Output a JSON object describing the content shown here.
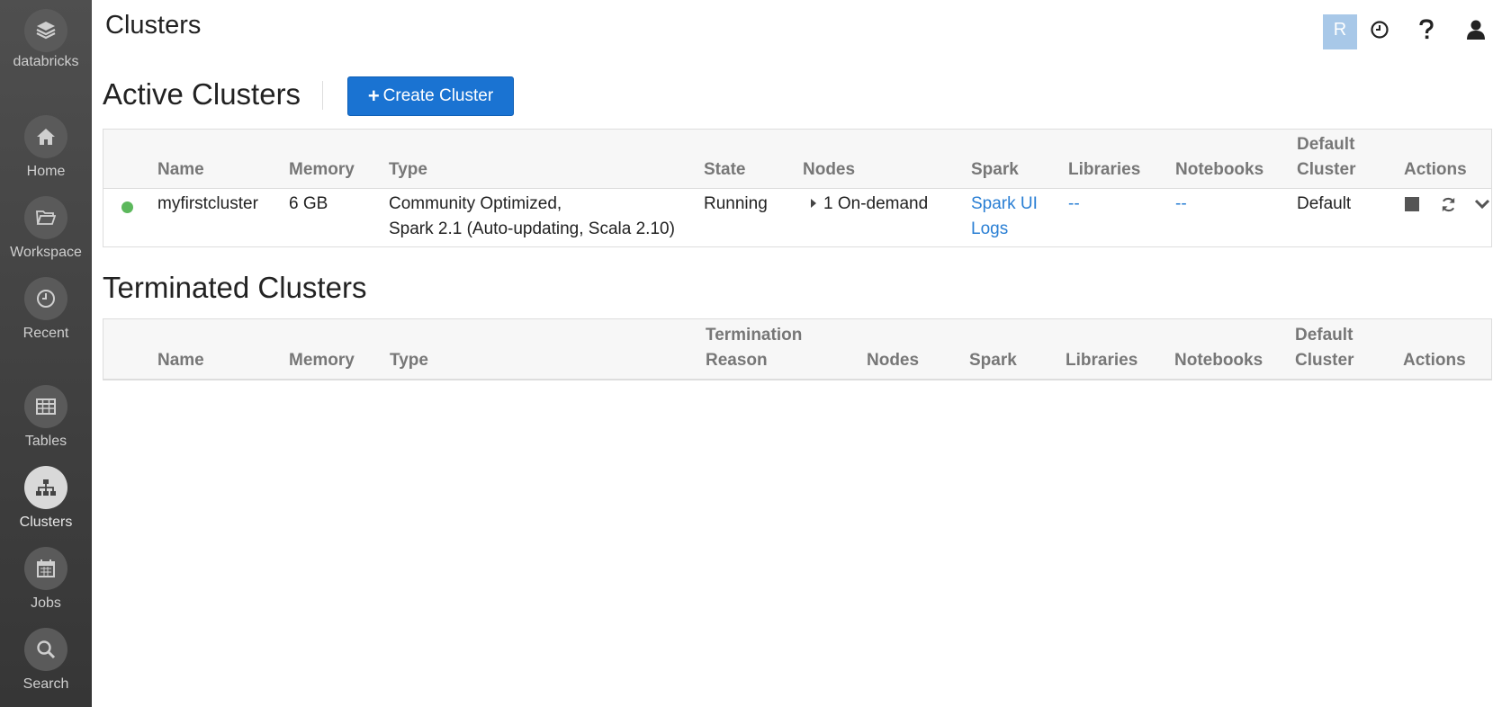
{
  "sidebar": {
    "brand": "databricks",
    "items": [
      {
        "label": "Home",
        "icon": "home-icon"
      },
      {
        "label": "Workspace",
        "icon": "folder-icon"
      },
      {
        "label": "Recent",
        "icon": "clock-icon"
      },
      {
        "label": "Tables",
        "icon": "table-icon"
      },
      {
        "label": "Clusters",
        "icon": "sitemap-icon",
        "active": true
      },
      {
        "label": "Jobs",
        "icon": "calendar-icon"
      },
      {
        "label": "Search",
        "icon": "search-icon"
      }
    ]
  },
  "header": {
    "title": "Clusters",
    "user_initial": "R"
  },
  "active": {
    "title": "Active Clusters",
    "create_label": "Create Cluster",
    "columns": {
      "name": "Name",
      "memory": "Memory",
      "type": "Type",
      "state": "State",
      "nodes": "Nodes",
      "spark": "Spark",
      "libraries": "Libraries",
      "notebooks": "Notebooks",
      "default_1": "Default",
      "default_2": "Cluster",
      "actions": "Actions"
    },
    "rows": [
      {
        "name": "myfirstcluster",
        "memory": "6 GB",
        "type_1": "Community Optimized,",
        "type_2": "Spark 2.1 (Auto-updating, Scala 2.10)",
        "state": "Running",
        "nodes": "1 On-demand",
        "spark_ui": "Spark UI",
        "logs": "Logs",
        "libraries": "--",
        "notebooks": "--",
        "default": "Default",
        "status_color": "#5cb85c"
      }
    ]
  },
  "terminated": {
    "title": "Terminated Clusters",
    "columns": {
      "name": "Name",
      "memory": "Memory",
      "type": "Type",
      "reason_1": "Termination",
      "reason_2": "Reason",
      "nodes": "Nodes",
      "spark": "Spark",
      "libraries": "Libraries",
      "notebooks": "Notebooks",
      "default_1": "Default",
      "default_2": "Cluster",
      "actions": "Actions"
    }
  },
  "colors": {
    "accent": "#1a73d2",
    "link": "#2a7fd4",
    "sidebar": "#444444"
  }
}
